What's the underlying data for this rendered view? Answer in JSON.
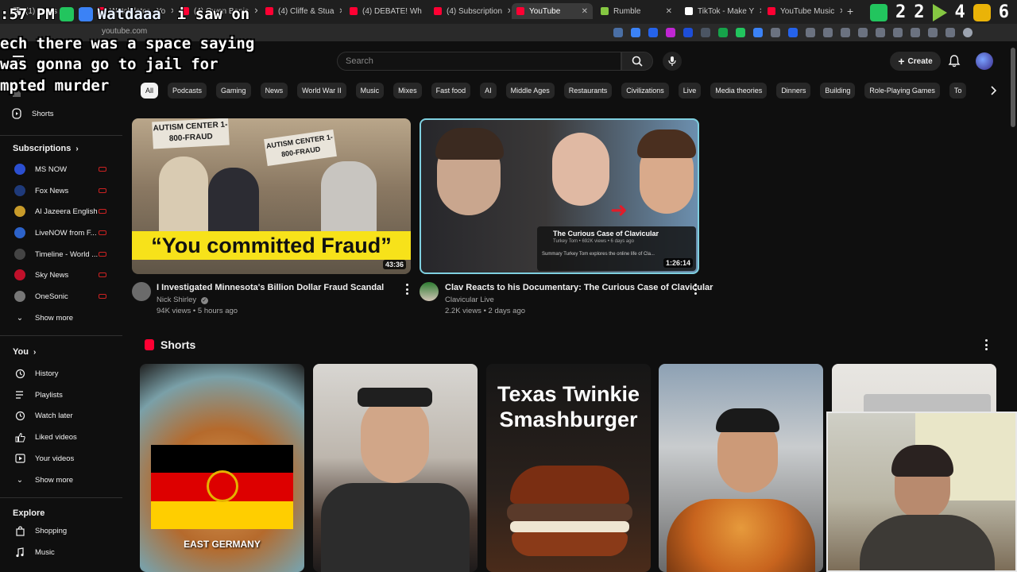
{
  "browser": {
    "tabs": [
      {
        "label": "(1) Posts / X",
        "color": "#dddddd"
      },
      {
        "label": "Watch later - Yo",
        "color": "#ff0033"
      },
      {
        "label": "(4) Owen Benja",
        "color": "#ff0033"
      },
      {
        "label": "(4) Cliffe & Stua",
        "color": "#ff0033"
      },
      {
        "label": "(4) DEBATE! Wh",
        "color": "#ff0033"
      },
      {
        "label": "(4) Subscription",
        "color": "#ff0033"
      },
      {
        "label": "YouTube",
        "color": "#ff0033"
      },
      {
        "label": "Rumble",
        "color": "#85c742"
      },
      {
        "label": "TikTok - Make Y",
        "color": "#ffffff"
      },
      {
        "label": "YouTube Music",
        "color": "#ff0033"
      }
    ],
    "url": "youtube.com"
  },
  "overlay": {
    "time_fragment": ":57 PM",
    "username": "Watdaaa",
    "message_line1": "i saw on",
    "message_line2": "ech there was a space saying",
    "message_line3": "was gonna go to jail for",
    "message_line4": "mpted murder",
    "stat_a": "2",
    "stat_b": "2",
    "stat_c": "4",
    "stat_d": "6"
  },
  "header": {
    "search_placeholder": "Search",
    "create_label": "Create"
  },
  "chips": [
    "All",
    "Podcasts",
    "Gaming",
    "News",
    "World War II",
    "Music",
    "Mixes",
    "Fast food",
    "AI",
    "Middle Ages",
    "Restaurants",
    "Civilizations",
    "Live",
    "Media theories",
    "Dinners",
    "Building",
    "Role-Playing Games",
    "To"
  ],
  "sidebar": {
    "shorts": "Shorts",
    "subscriptions_heading": "Subscriptions",
    "subscriptions": [
      {
        "label": "MS NOW",
        "color": "#2b4fd1"
      },
      {
        "label": "Fox News",
        "color": "#1f3a7a"
      },
      {
        "label": "Al Jazeera English",
        "color": "#c89b2a"
      },
      {
        "label": "LiveNOW from F...",
        "color": "#2c62c9"
      },
      {
        "label": "Timeline - World ...",
        "color": "#444444"
      },
      {
        "label": "Sky News",
        "color": "#c0102a"
      },
      {
        "label": "OneSonic",
        "color": "#777777"
      }
    ],
    "show_more_1": "Show more",
    "you_heading": "You",
    "you_items": [
      "History",
      "Playlists",
      "Watch later",
      "Liked videos",
      "Your videos"
    ],
    "show_more_2": "Show more",
    "explore_heading": "Explore",
    "explore_items": [
      "Shopping",
      "Music"
    ]
  },
  "videos": [
    {
      "title": "I Investigated Minnesota's Billion Dollar Fraud Scandal",
      "channel": "Nick Shirley",
      "meta": "94K views • 5 hours ago",
      "duration": "43:36",
      "thumb_caption": "“You committed Fraud”",
      "sign1": "AUTISM CENTER 1-800-FRAUD",
      "sign2": "AUTISM CENTER 1-800-FRAUD"
    },
    {
      "title": "Clav Reacts to his Documentary: The Curious Case of Clavicular",
      "channel": "Clavicular Live",
      "meta": "2.2K views • 2 days ago",
      "duration": "1:26:14",
      "inset_title": "The Curious Case of Clavicular",
      "inset_sub": "Turkey Tom • 692K views • 6 days ago",
      "inset_summary": "Summary   Turkey Tom explores the online life of Cla..."
    }
  ],
  "shorts": {
    "heading": "Shorts",
    "items": [
      {
        "caption": "EAST GERMANY"
      },
      {
        "caption": ""
      },
      {
        "caption": "Texas Twinkie Smashburger"
      },
      {
        "caption": ""
      },
      {
        "caption": ""
      }
    ]
  }
}
